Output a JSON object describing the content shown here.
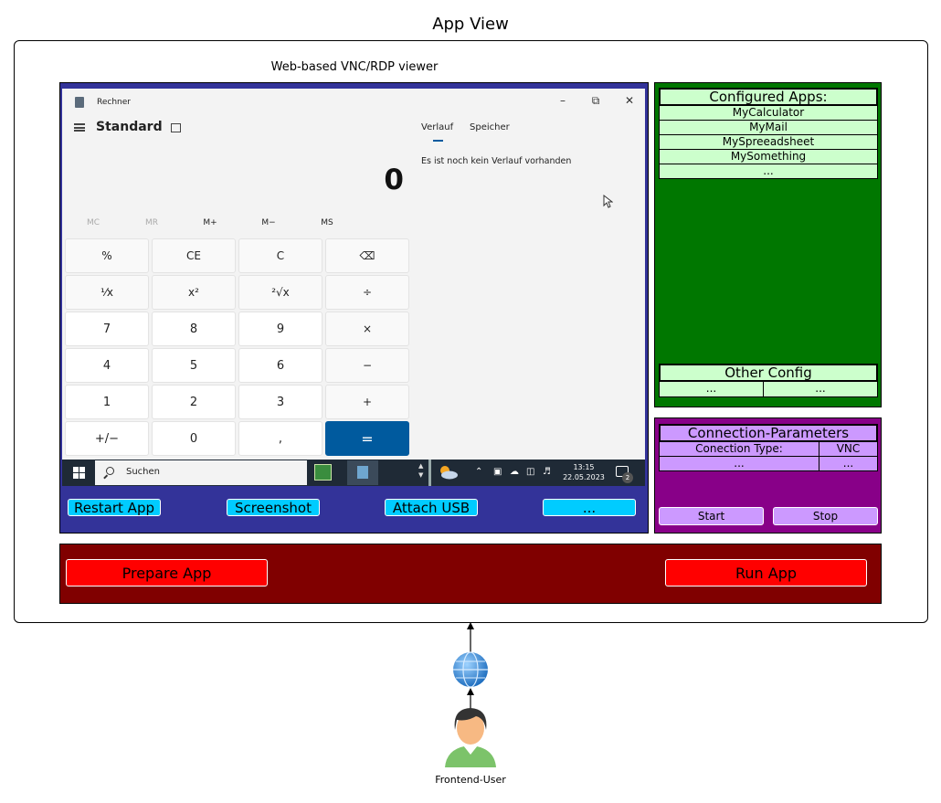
{
  "title": "App View",
  "viewer": {
    "label": "Web-based VNC/RDP viewer",
    "buttons": [
      "Restart App",
      "Screenshot",
      "Attach USB",
      "..."
    ]
  },
  "calculator": {
    "window_title": "Rechner",
    "mode": "Standard",
    "display": "0",
    "memory": [
      "MC",
      "MR",
      "M+",
      "M−",
      "MS"
    ],
    "keys": [
      [
        "%",
        "CE",
        "C",
        "⌫"
      ],
      [
        "¹⁄x",
        "x²",
        "²√x",
        "÷"
      ],
      [
        "7",
        "8",
        "9",
        "×"
      ],
      [
        "4",
        "5",
        "6",
        "−"
      ],
      [
        "1",
        "2",
        "3",
        "+"
      ],
      [
        "+/−",
        "0",
        ",",
        "="
      ]
    ],
    "tabs": [
      "Verlauf",
      "Speicher"
    ],
    "history_empty": "Es ist noch kein Verlauf vorhanden"
  },
  "taskbar": {
    "search": "Suchen",
    "time": "13:15",
    "date": "22.05.2023",
    "notifications": "2"
  },
  "configured_apps": {
    "header": "Configured Apps:",
    "items": [
      "MyCalculator",
      "MyMail",
      "MySpreeadsheet",
      "MySomething",
      "..."
    ]
  },
  "other_config": {
    "header": "Other Config",
    "cells": [
      "...",
      "..."
    ]
  },
  "connection": {
    "header": "Connection-Parameters",
    "rows": [
      [
        "Conection Type:",
        "VNC"
      ],
      [
        "...",
        "..."
      ]
    ],
    "start": "Start",
    "stop": "Stop"
  },
  "actions": {
    "prepare": "Prepare App",
    "run": "Run App"
  },
  "user": {
    "label": "Frontend-User"
  },
  "colors": {
    "viewer": "#333399",
    "config": "#007700",
    "connection": "#880088",
    "actions": "#800000",
    "viewer_buttons": "#00ccff",
    "action_buttons": "#ff0000",
    "accent": "#005a9e"
  }
}
